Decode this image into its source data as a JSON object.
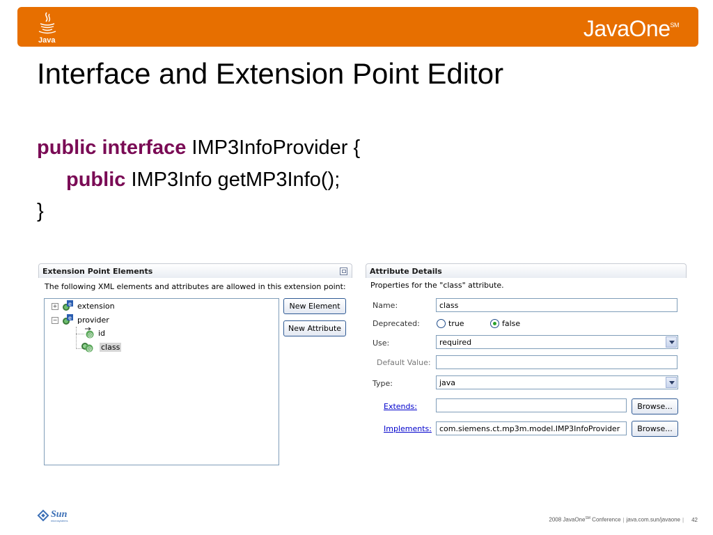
{
  "header": {
    "java_logo_text": "Java",
    "javaone_logo": "JavaOne",
    "trademark": "SM",
    "accent_color": "#e76f00"
  },
  "slide": {
    "title": "Interface and Extension Point Editor"
  },
  "code": {
    "line1_kw": "public interface",
    "line1_rest": " IMP3InfoProvider {",
    "line2_kw": "public",
    "line2_rest": " IMP3Info getMP3Info();",
    "line3": "}",
    "keyword_color": "#7a0b55"
  },
  "left_panel": {
    "title": "Extension Point Elements",
    "description": "The following XML elements and attributes are allowed in this extension point:",
    "tree": [
      {
        "label": "extension",
        "expander": "+",
        "icon": "element-icon"
      },
      {
        "label": "provider",
        "expander": "−",
        "icon": "element-icon"
      },
      {
        "label": "id",
        "icon": "attribute-icon"
      },
      {
        "label": "class",
        "icon": "attribute-icon",
        "selected": true
      }
    ],
    "new_element_button": "New Element",
    "new_attribute_button": "New Attribute"
  },
  "right_panel": {
    "title": "Attribute Details",
    "description": "Properties for the \"class\" attribute.",
    "name_label": "Name:",
    "name_value": "class",
    "deprecated_label": "Deprecated:",
    "deprecated_true": "true",
    "deprecated_false": "false",
    "deprecated_selected": "false",
    "use_label": "Use:",
    "use_value": "required",
    "default_label": "Default Value:",
    "default_value": "",
    "type_label": "Type:",
    "type_value": "java",
    "extends_label": "Extends:",
    "extends_value": "",
    "implements_label": "Implements:",
    "implements_value": "com.siemens.ct.mp3m.model.IMP3InfoProvider",
    "browse_label": "Browse..."
  },
  "footer": {
    "sun_logo": "Sun",
    "sun_sub": "microsystems",
    "year": "2008 JavaOne",
    "sm": "SM",
    "conference": " Conference",
    "url": "java.com.sun/javaone",
    "page": "42"
  }
}
